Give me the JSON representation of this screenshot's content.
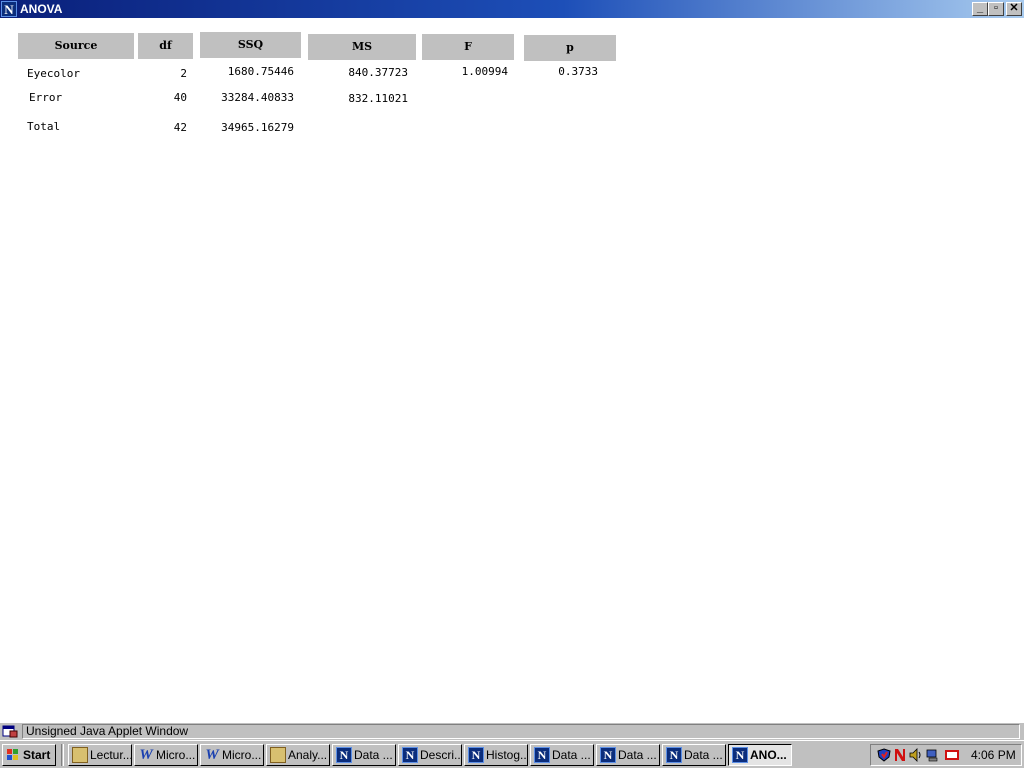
{
  "window": {
    "title": "ANOVA",
    "logo_letter": "N",
    "controls": {
      "minimize": "_",
      "maximize": "▫",
      "close": "✕"
    }
  },
  "anova": {
    "headers": [
      "Source",
      "df",
      "SSQ",
      "MS",
      "F",
      "p"
    ],
    "rows": [
      {
        "source": "Eyecolor",
        "df": "2",
        "ssq": "1680.75446",
        "ms": "840.37723",
        "f": "1.00994",
        "p": "0.3733"
      },
      {
        "source": "Error",
        "df": "40",
        "ssq": "33284.40833",
        "ms": "832.11021",
        "f": "",
        "p": ""
      },
      {
        "source": "Total",
        "df": "42",
        "ssq": "34965.16279",
        "ms": "",
        "f": "",
        "p": ""
      }
    ]
  },
  "statusbar": {
    "text": "Unsigned Java Applet Window"
  },
  "taskbar": {
    "start_label": "Start",
    "tasks": [
      {
        "label": "Lectur...",
        "icon": "spider-icon"
      },
      {
        "label": "Micro...",
        "icon": "word-icon"
      },
      {
        "label": "Micro...",
        "icon": "word-icon"
      },
      {
        "label": "Analy...",
        "icon": "spider-icon"
      },
      {
        "label": "Data ...",
        "icon": "netscape-icon"
      },
      {
        "label": "Descri...",
        "icon": "netscape-icon"
      },
      {
        "label": "Histog...",
        "icon": "netscape-icon"
      },
      {
        "label": "Data ...",
        "icon": "netscape-icon"
      },
      {
        "label": "Data ...",
        "icon": "netscape-icon"
      },
      {
        "label": "Data ...",
        "icon": "netscape-icon"
      },
      {
        "label": "ANO...",
        "icon": "netscape-icon",
        "active": true
      }
    ],
    "clock": "4:06 PM"
  },
  "colors": {
    "titlebar": "#0a1f7a",
    "header_bg": "#c0c0c0",
    "face": "#c0c0c0"
  }
}
